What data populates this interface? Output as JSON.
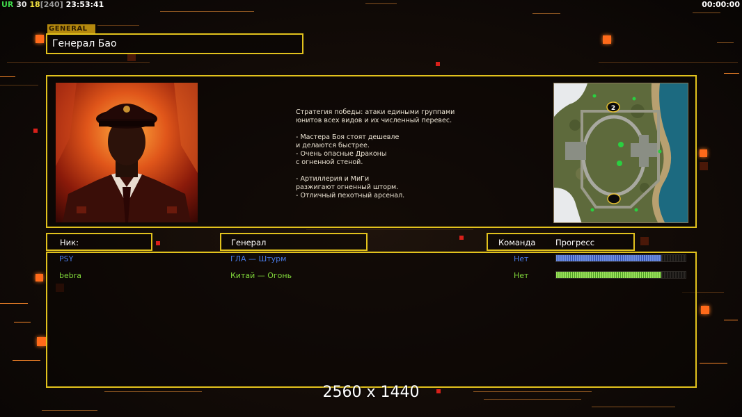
{
  "hud": {
    "ur_label": "UR",
    "fps": "30",
    "latency": "18",
    "bracket_value": "[240]",
    "clock": "23:53:41",
    "timer": "00:00:00"
  },
  "general_tag": "GENERAL",
  "general_name": "Генерал Бао",
  "description": "Стратегия победы: атаки едиными группами\nюнитов всех видов и их численный перевес.\n\n- Мастера Боя стоят дешевле\nи делаются быстрее.\n- Очень опасные Драконы\nс огненной стеной.\n\n- Артиллерия и МиГи\nразжигают огненный шторм.\n- Отличный пехотный арсенал.",
  "map_badge": "2",
  "columns": {
    "nick": "Ник:",
    "general": "Генерал",
    "team": "Команда",
    "progress": "Прогресс"
  },
  "players": [
    {
      "nick": "PSY",
      "general": "ГЛА — Штурм",
      "team": "Нет",
      "progress": 0.81,
      "color": "#4a7be6"
    },
    {
      "nick": "bebra",
      "general": "Китай — Огонь",
      "team": "Нет",
      "progress": 0.81,
      "color": "#7fd63a"
    }
  ],
  "resolution_label": "2560 x 1440",
  "colors": {
    "accent": "#e2c21d",
    "orange": "#ff6a1a"
  }
}
